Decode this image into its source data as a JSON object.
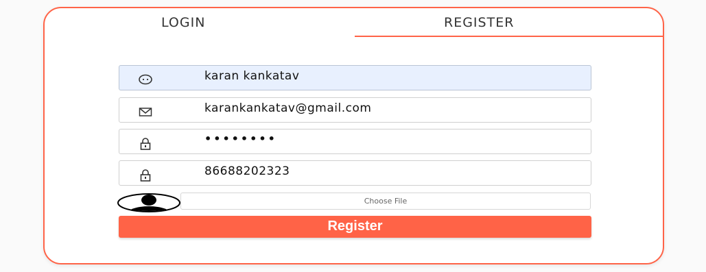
{
  "tabs": {
    "login": "LOGIN",
    "register": "REGISTER",
    "active": "register"
  },
  "form": {
    "name": {
      "value": "karan kankatav",
      "icon": "face-icon",
      "autofilled": true
    },
    "email": {
      "value": "karankankatav@gmail.com",
      "icon": "mail-icon"
    },
    "password": {
      "value": "••••••••",
      "icon": "lock-icon"
    },
    "phone": {
      "value": "86688202323",
      "icon": "lock-icon"
    },
    "avatar": {
      "icon": "user-avatar-icon"
    },
    "file": {
      "label": "Choose File"
    },
    "submit": {
      "label": "Register"
    }
  },
  "colors": {
    "accent": "#ff6347",
    "autofill_bg": "#e8f0fe",
    "text": "#111111"
  }
}
